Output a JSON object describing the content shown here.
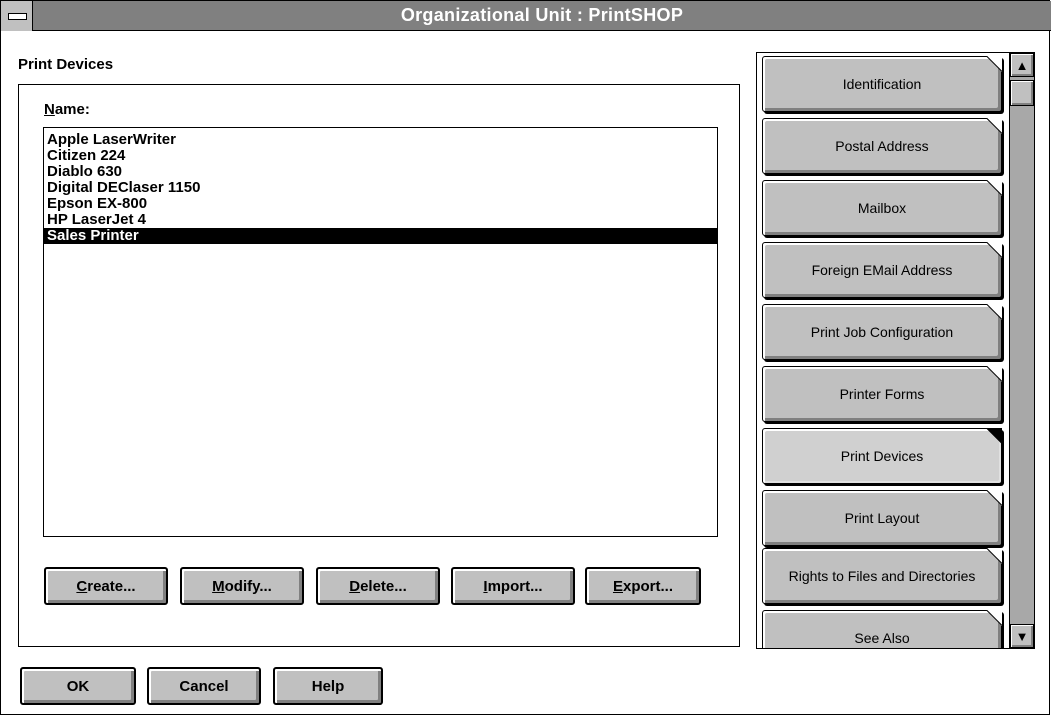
{
  "window": {
    "title": "Organizational Unit : PrintSHOP"
  },
  "section": {
    "label": "Print Devices"
  },
  "name_label": "Name:",
  "devices": [
    "Apple LaserWriter",
    "Citizen 224",
    "Diablo 630",
    "Digital DEClaser 1150",
    "Epson EX-800",
    "HP LaserJet 4",
    "Sales Printer"
  ],
  "selected_device": "Sales Printer",
  "list_buttons": {
    "create": "Create...",
    "modify": "Modify...",
    "delete": "Delete...",
    "import": "Import...",
    "export": "Export..."
  },
  "dialog_buttons": {
    "ok": "OK",
    "cancel": "Cancel",
    "help": "Help"
  },
  "tabs": [
    "Identification",
    "Postal Address",
    "Mailbox",
    "Foreign EMail Address",
    "Print Job Configuration",
    "Printer Forms",
    "Print Devices",
    "Print Layout",
    "Rights to Files and Directories",
    "See Also"
  ],
  "active_tab": "Print Devices",
  "icons": {
    "system_menu": "system-menu-icon",
    "scroll_up": "arrow-up-icon",
    "scroll_down": "arrow-down-icon"
  },
  "colors": {
    "titlebar": "#808080",
    "face": "#c0c0c0",
    "selection": "#000000"
  }
}
